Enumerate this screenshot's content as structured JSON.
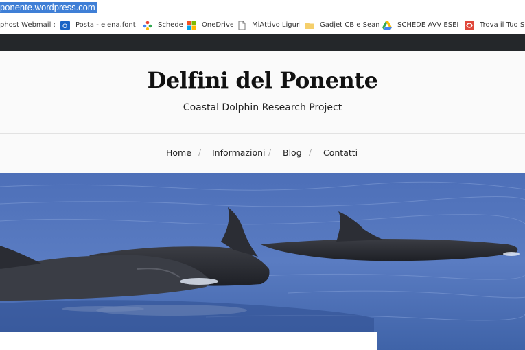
{
  "browser": {
    "address": "ponente.wordpress.com",
    "bookmarks": [
      {
        "label": "phost Webmail :: E",
        "icon": "webmail-icon"
      },
      {
        "label": "Posta - elena.fontanc",
        "icon": "outlook-icon"
      },
      {
        "label": "Schede",
        "icon": "schede-icon"
      },
      {
        "label": "OneDrive",
        "icon": "windows-icon"
      },
      {
        "label": "MiAttivo Liguria",
        "icon": "page-icon"
      },
      {
        "label": "Gadjet CB e Seame",
        "icon": "folder-icon"
      },
      {
        "label": "SCHEDE AVV ESEMPI",
        "icon": "google-drive-icon"
      },
      {
        "label": "Trova il Tuo Spo",
        "icon": "red-app-icon"
      }
    ]
  },
  "site": {
    "title": "Delfini del Ponente",
    "tagline": "Coastal Dolphin Research Project",
    "nav": [
      "Home",
      "Informazioni",
      "Blog",
      "Contatti"
    ],
    "nav_separator": "/",
    "hero_image": "dolphins-photo"
  },
  "colors": {
    "topbar": "#24272a",
    "selection": "#3f7fd6",
    "sea": "#4e6fb4"
  }
}
